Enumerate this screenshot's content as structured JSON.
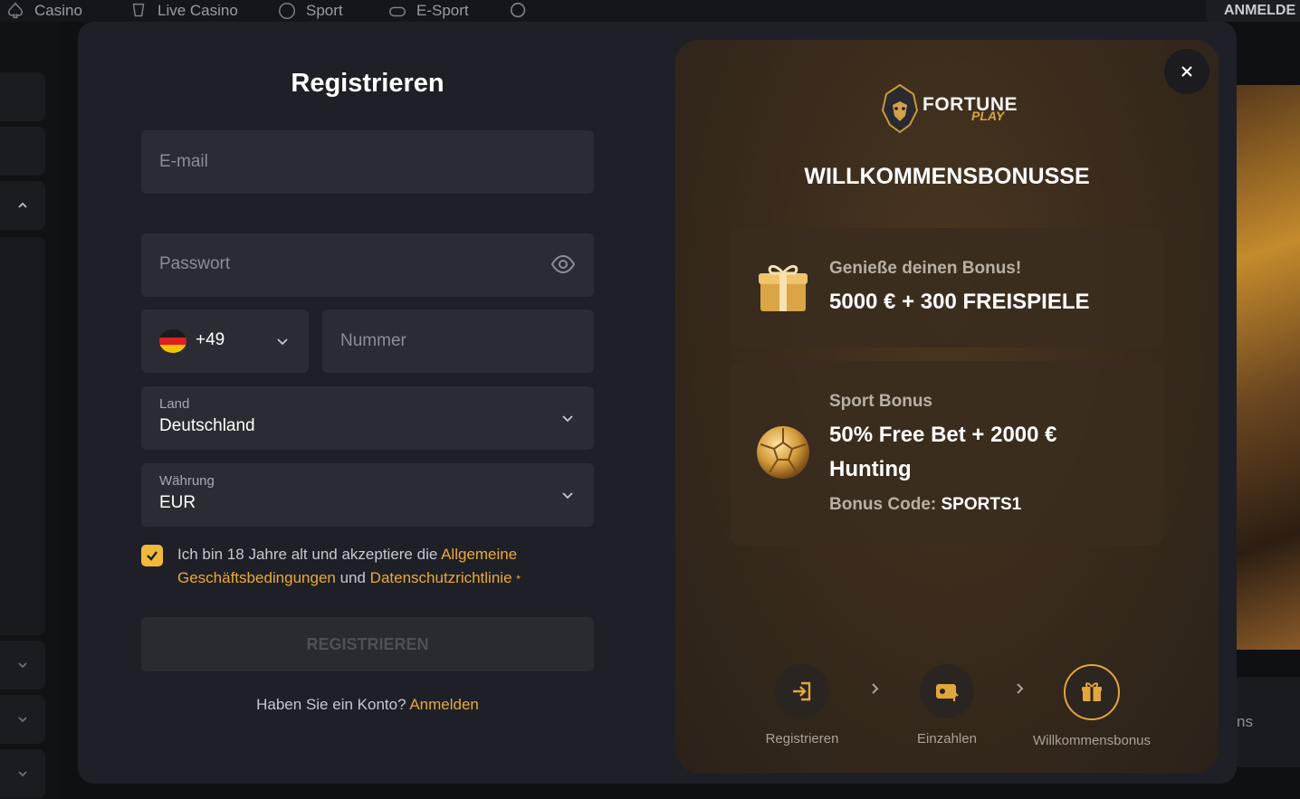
{
  "topnav": {
    "items": [
      "Casino",
      "Live Casino",
      "Sport",
      "E-Sport"
    ],
    "login_label": "ANMELDE"
  },
  "background": {
    "right_text": "ns"
  },
  "form": {
    "title": "Registrieren",
    "email_placeholder": "E-mail",
    "password_placeholder": "Passwort",
    "phone_code": "+49",
    "phone_placeholder": "Nummer",
    "country_label": "Land",
    "country_value": "Deutschland",
    "currency_label": "Währung",
    "currency_value": "EUR",
    "consent_text_1": "Ich bin 18 Jahre alt und akzeptiere die ",
    "consent_link_terms": "Allgemeine Geschäftsbedingungen",
    "consent_text_2": " und ",
    "consent_link_privacy": "Datenschutzrichtlinie",
    "consent_required": "*",
    "consent_checked": true,
    "submit_label": "REGISTRIEREN",
    "have_account_text": "Haben Sie ein Konto? ",
    "login_link": "Anmelden"
  },
  "promo": {
    "logo_main": "FORTUNE",
    "logo_sub": "PLAY",
    "title": "WILLKOMMENSBONUSSE",
    "casino_bonus": {
      "subtitle": "Genieße deinen Bonus!",
      "main": "5000 € + 300 FREISPIELE"
    },
    "sport_bonus": {
      "subtitle": "Sport Bonus",
      "main_line1": "50% Free Bet + 2000 €",
      "main_line2": "Hunting",
      "code_label": "Bonus Code: ",
      "code_value": "SPORTS1"
    },
    "steps": [
      "Registrieren",
      "Einzahlen",
      "Willkommensbonus"
    ],
    "active_step": 3
  },
  "colors": {
    "accent": "#e8a93a",
    "modal_bg": "#1f2027",
    "field_bg": "#2b2c33"
  }
}
